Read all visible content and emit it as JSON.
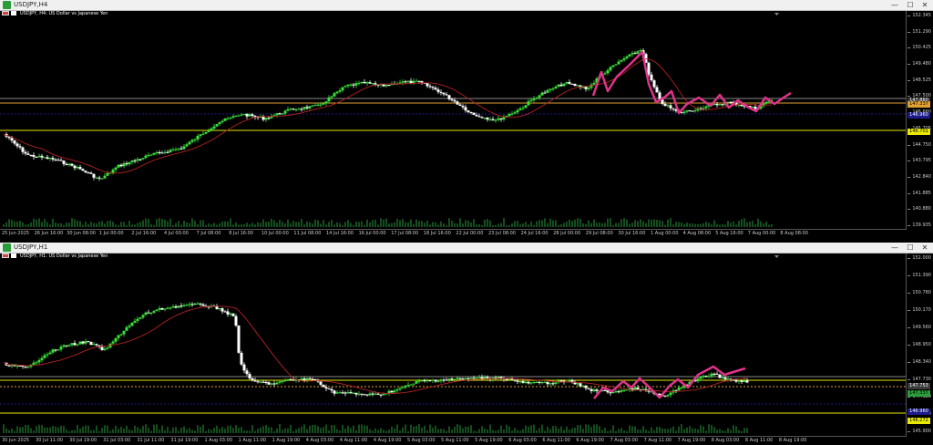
{
  "windows": [
    {
      "title": "USDJPY,H4",
      "chart_label": "USDJPY, H4:  US Dollar vs Japanese Yen",
      "price_ticks": [
        "152.345",
        "151.290",
        "150.425",
        "149.480",
        "148.525",
        "147.500",
        "146.660",
        "145.705",
        "144.750",
        "143.795",
        "142.840",
        "141.885",
        "140.880",
        "139.935"
      ],
      "price_labels": [
        {
          "text": "147.860",
          "bg": "#3a3a3a"
        },
        {
          "text": "147.337",
          "bg": "#e0a030"
        },
        {
          "text": "146.960",
          "bg": "#1a1a8a"
        },
        {
          "text": "146.701",
          "bg": "#e8e800"
        }
      ],
      "time_ticks": [
        "25 Jun 2025",
        "26 Jun 16:00",
        "30 Jun 08:00",
        "1 Jul 00:00",
        "2 Jul 16:00",
        "4 Jul 00:00",
        "7 Jul 08:00",
        "8 Jul 16:00",
        "10 Jul 00:00",
        "11 Jul 08:00",
        "14 Jul 16:00",
        "16 Jul 00:00",
        "17 Jul 08:00",
        "18 Jul 16:00",
        "22 Jul 00:00",
        "23 Jul 08:00",
        "24 Jul 16:00",
        "28 Jul 00:00",
        "29 Jul 08:00",
        "30 Jul 16:00",
        "1 Aug 00:00",
        "4 Aug 08:00",
        "5 Aug 16:00",
        "7 Aug 00:00",
        "8 Aug 08:00"
      ]
    },
    {
      "title": "USDJPY,H1",
      "chart_label": "USDJPY, H1:  US Dollar vs Japanese Yen",
      "price_ticks": [
        "152.000",
        "151.390",
        "150.780",
        "150.170",
        "149.560",
        "148.950",
        "148.340",
        "147.730",
        "147.120",
        "146.510",
        "145.900"
      ],
      "price_labels": [
        {
          "text": "147.753",
          "bg": "#3a3a3a"
        },
        {
          "text": "147.337",
          "bg": "#2a9d3b"
        },
        {
          "text": "146.960",
          "bg": "#1a1a8a"
        },
        {
          "text": "146.272",
          "bg": "#e8e800"
        }
      ],
      "time_ticks": [
        "30 Jun 2025",
        "30 Jul 11:00",
        "30 Jul 19:00",
        "31 Jul 03:00",
        "31 Jul 11:00",
        "31 Jul 19:00",
        "1 Aug 03:00",
        "1 Aug 11:00",
        "1 Aug 19:00",
        "4 Aug 03:00",
        "4 Aug 11:00",
        "4 Aug 19:00",
        "5 Aug 03:00",
        "5 Aug 11:00",
        "5 Aug 19:00",
        "6 Aug 03:00",
        "6 Aug 11:00",
        "6 Aug 19:00",
        "7 Aug 03:00",
        "7 Aug 11:00",
        "7 Aug 19:00",
        "8 Aug 03:00",
        "8 Aug 11:00",
        "8 Aug 19:00"
      ]
    }
  ],
  "window_buttons": {
    "minimize": "—",
    "maximize": "☐",
    "close": "✕"
  },
  "colors": {
    "bull": "#39e339",
    "bear": "#ffffff",
    "ma": "#b22222",
    "projection": "#e0338a",
    "line_yellow": "#e8e800",
    "line_orange": "#e0a030",
    "line_blue": "#1a1a8a",
    "line_grey": "#888888"
  }
}
